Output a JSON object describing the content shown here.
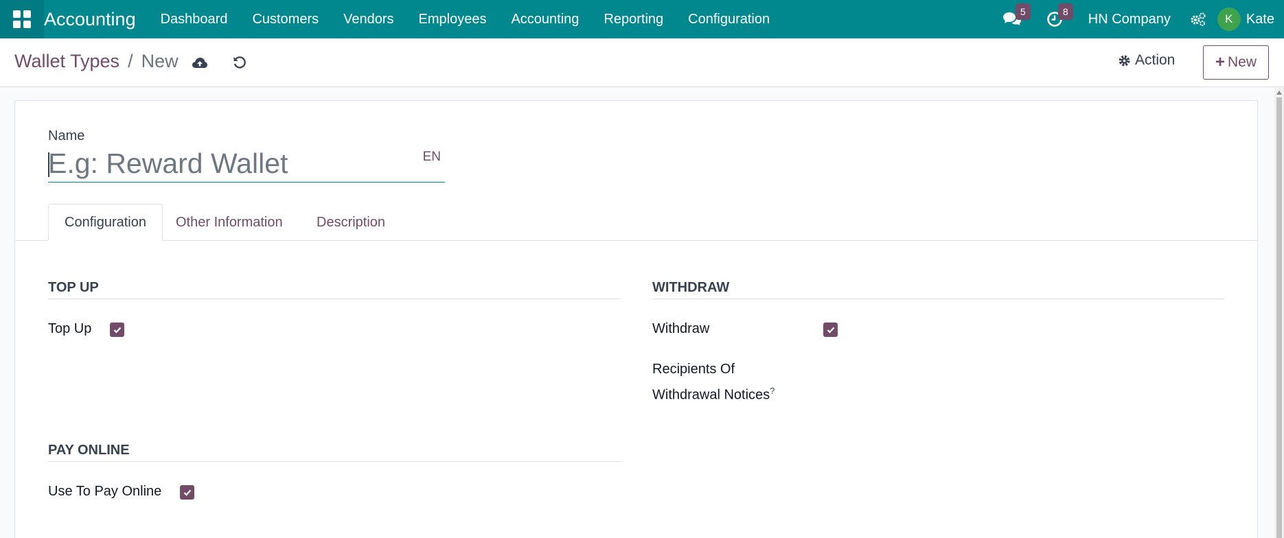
{
  "navbar": {
    "app_name": "Accounting",
    "menu": [
      "Dashboard",
      "Customers",
      "Vendors",
      "Employees",
      "Accounting",
      "Reporting",
      "Configuration"
    ],
    "messages_count": "5",
    "activities_count": "8",
    "company": "HN Company",
    "user_initial": "K",
    "user_name": "Kate",
    "color": "#01888f"
  },
  "control_panel": {
    "breadcrumb_parent": "Wallet Types",
    "breadcrumb_separator": "/",
    "breadcrumb_current": "New",
    "action_label": "Action",
    "new_label": "New"
  },
  "form": {
    "name_label": "Name",
    "name_value": "",
    "name_placeholder": "E.g: Reward Wallet",
    "lang": "EN",
    "tabs": [
      {
        "label": "Configuration",
        "active": true
      },
      {
        "label": "Other Information",
        "active": false
      },
      {
        "label": "Description",
        "active": false
      }
    ],
    "groups": {
      "top_up": {
        "title": "Top Up",
        "field_label": "Top Up",
        "checked": true
      },
      "withdraw": {
        "title": "Withdraw",
        "field_label": "Withdraw",
        "checked": true,
        "recipients_label_line1": "Recipients Of",
        "recipients_label_line2": "Withdrawal Notices",
        "help_mark": "?"
      },
      "pay_online": {
        "title": "Pay Online",
        "field_label": "Use To Pay Online",
        "checked": true
      }
    }
  },
  "colors": {
    "accent": "#714b67",
    "navbar": "#01888f"
  }
}
